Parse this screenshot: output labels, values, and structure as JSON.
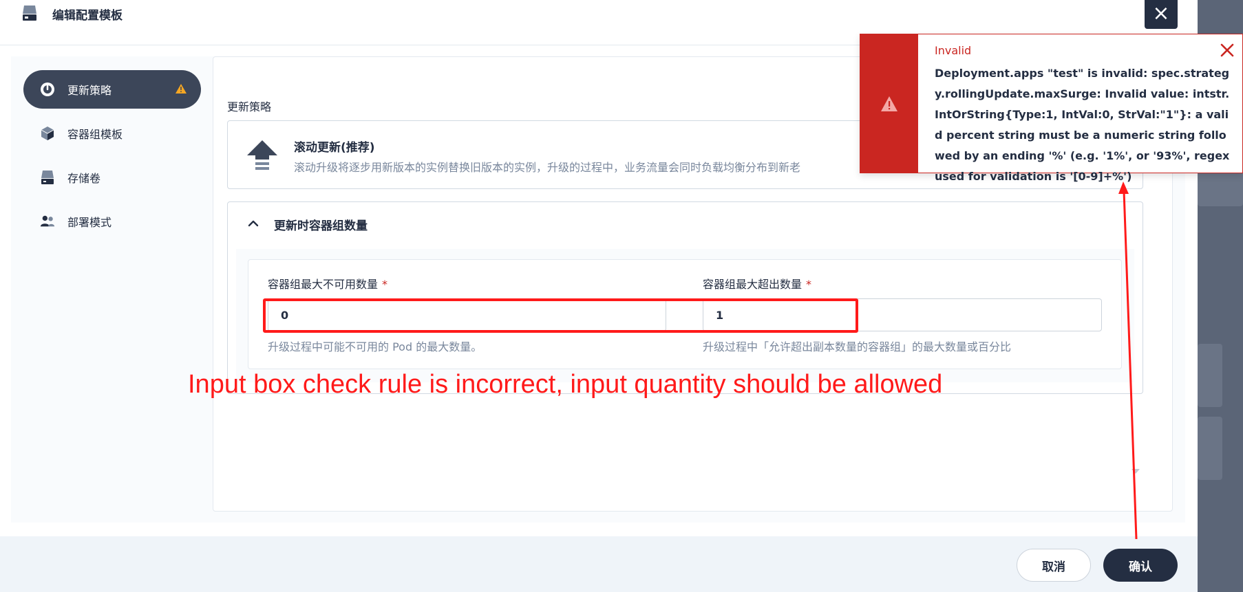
{
  "modal": {
    "title": "编辑配置模板",
    "close_symbol": "×"
  },
  "sidebar": {
    "items": [
      {
        "label": "更新策略",
        "icon": "gauge-icon",
        "active": true,
        "warning": true
      },
      {
        "label": "容器组模板",
        "icon": "cube-icon",
        "active": false
      },
      {
        "label": "存储卷",
        "icon": "disk-icon",
        "active": false
      },
      {
        "label": "部署模式",
        "icon": "users-icon",
        "active": false
      }
    ]
  },
  "main": {
    "section_label": "更新策略",
    "strategy": {
      "title": "滚动更新(推荐)",
      "description": "滚动升级将逐步用新版本的实例替换旧版本的实例，升级的过程中，业务流量会同时负载均衡分布到新老"
    },
    "pod_count": {
      "title": "更新时容器组数量",
      "max_unavailable": {
        "label": "容器组最大不可用数量",
        "required_mark": "*",
        "value": "0",
        "help": "升级过程中可能不可用的 Pod 的最大数量。"
      },
      "max_surge": {
        "label": "容器组最大超出数量",
        "required_mark": "*",
        "value": "1",
        "help": "升级过程中「允许超出副本数量的容器组」的最大数量或百分比"
      }
    }
  },
  "footer": {
    "cancel_label": "取消",
    "confirm_label": "确认"
  },
  "notification": {
    "title": "Invalid",
    "message": "Deployment.apps \"test\" is invalid: spec.strategy.rollingUpdate.maxSurge: Invalid value: intstr.IntOrString{Type:1, IntVal:0, StrVal:\"1\"}: a valid percent string must be a numeric string followed by an ending '%' (e.g. '1%', or '93%', regex used for validation is '[0-9]+%')",
    "color": "#ca2621"
  },
  "annotation": {
    "text": "Input box check rule is incorrect, input quantity should be allowed",
    "color": "#ff1a1a"
  },
  "colors": {
    "primary_dark": "#242e42",
    "nav_active": "#3c4659",
    "error": "#ca2621",
    "warning": "#f5a623",
    "muted_text": "#79879c"
  }
}
